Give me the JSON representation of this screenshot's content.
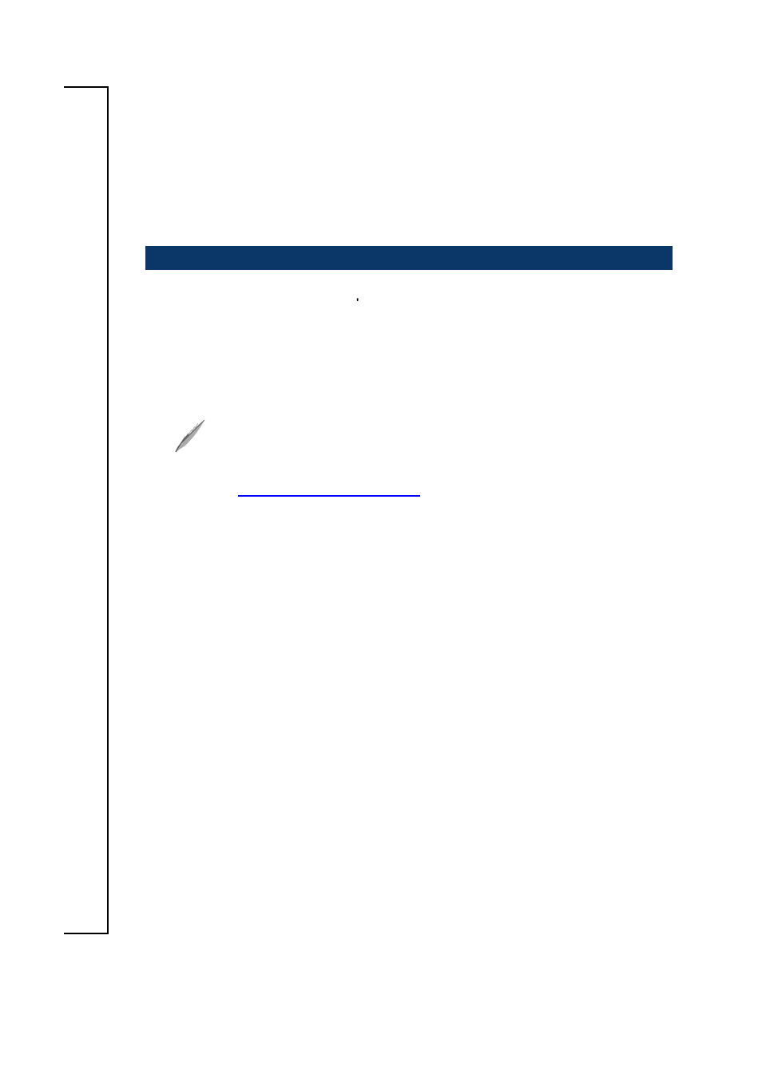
{
  "page": {
    "apostrophe": "'"
  }
}
